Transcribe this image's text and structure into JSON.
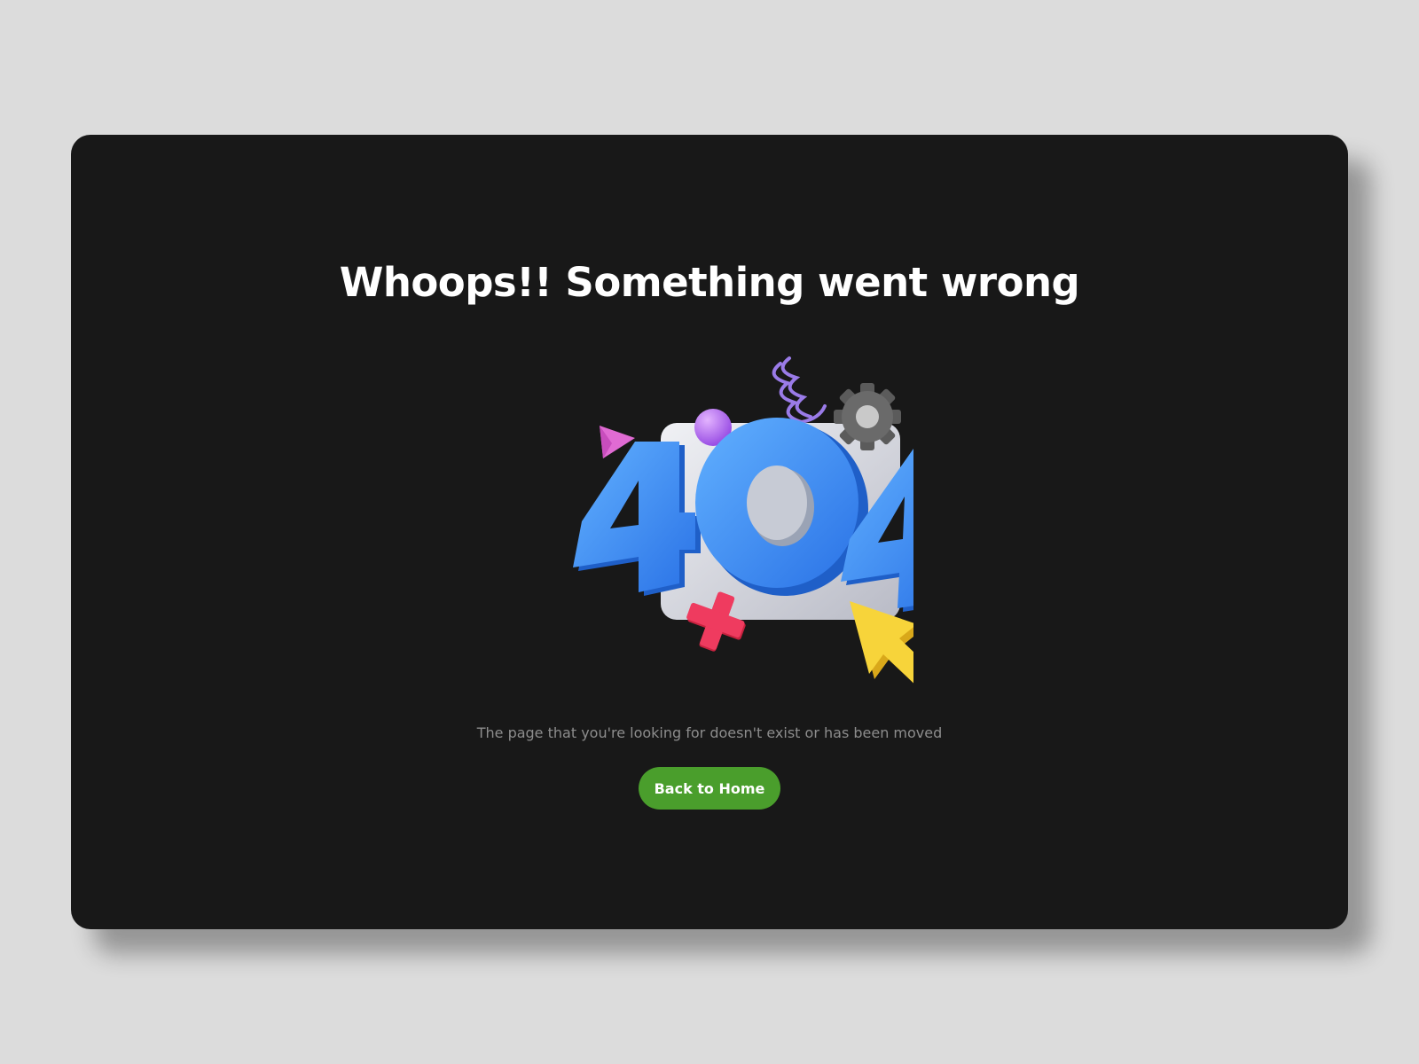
{
  "page": {
    "title": "Whoops!! Something went wrong",
    "message": "The page that you're looking for doesn't exist or has been moved",
    "home_button_label": "Back to Home"
  },
  "illustration": {
    "digits": [
      "4",
      "0",
      "4"
    ],
    "icons": [
      "spring-icon",
      "gear-icon",
      "hexagon-icon",
      "triangle-icon",
      "sphere-icon",
      "cross-icon",
      "cursor-arrow-icon",
      "window-panel-icon"
    ]
  },
  "colors": {
    "background": "#dcdcdc",
    "card": "#181818",
    "title": "#ffffff",
    "message": "#8d8d8d",
    "button": "#4a9e2c",
    "digits": "#3d8ff5",
    "panel": "#d9dae0",
    "cursor": "#f7d43a",
    "cross": "#e8335b",
    "triangle": "#e06bd3",
    "sphere": "#b45ff0",
    "gear": "#606060",
    "spring": "#9a7be8"
  }
}
